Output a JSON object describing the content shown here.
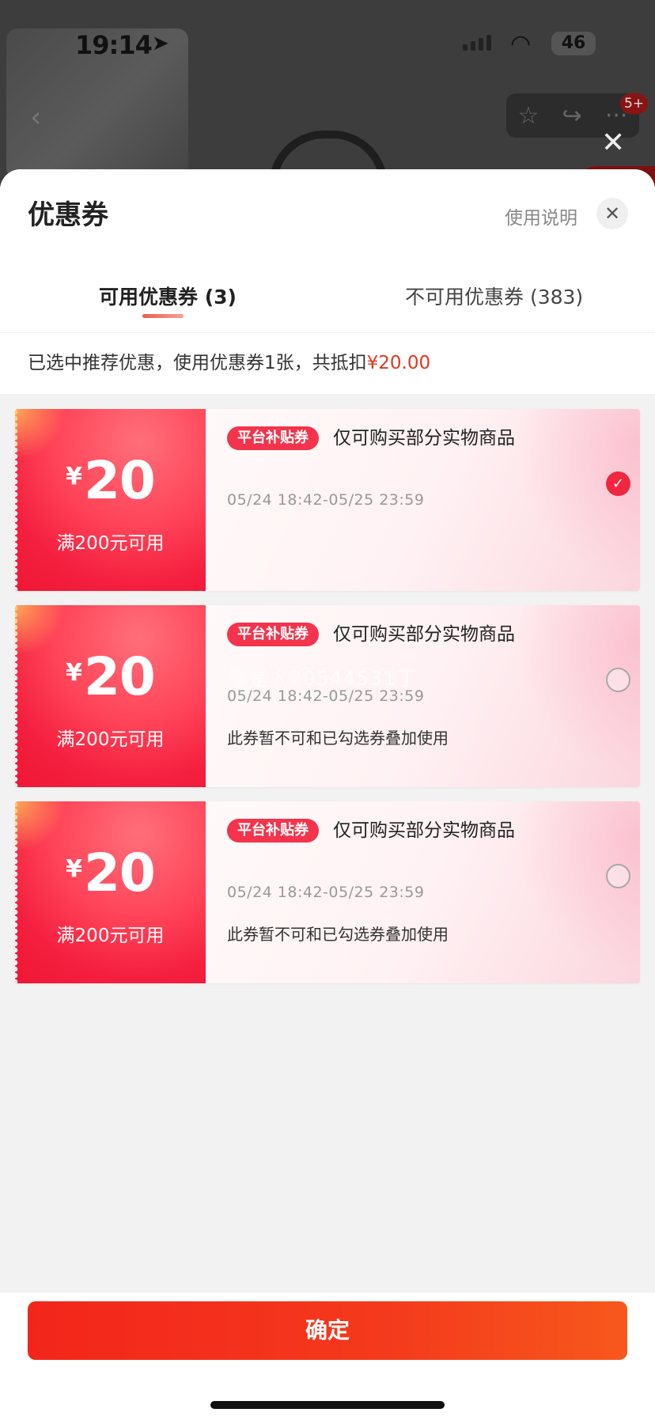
{
  "status_bar": {
    "time": "19:14",
    "battery": "46"
  },
  "background_page": {
    "cart_badge": "5+"
  },
  "sheet": {
    "title": "优惠券",
    "usage_link": "使用说明",
    "tabs": [
      {
        "label": "可用优惠券 (3)",
        "active": true
      },
      {
        "label": "不可用优惠券 (383)",
        "active": false
      }
    ],
    "summary": {
      "text": "已选中推荐优惠，使用优惠券1张，共抵扣",
      "amount": "¥20.00"
    }
  },
  "coupons": [
    {
      "currency": "¥",
      "value": "20",
      "condition": "满200元可用",
      "tag": "平台补贴券",
      "scope": "仅可购买部分实物商品",
      "validity": "05/24 18:42-05/25 23:59",
      "note": "",
      "selected": true
    },
    {
      "currency": "¥",
      "value": "20",
      "condition": "满200元可用",
      "tag": "平台补贴券",
      "scope": "仅可购买部分实物商品",
      "validity": "05/24 18:42-05/25 23:59",
      "note": "此券暂不可和已勾选券叠加使用",
      "selected": false
    },
    {
      "currency": "¥",
      "value": "20",
      "condition": "满200元可用",
      "tag": "平台补贴券",
      "scope": "仅可购买部分实物商品",
      "validity": "05/24 18:42-05/25 23:59",
      "note": "此券暂不可和已勾选券叠加使用",
      "selected": false
    }
  ],
  "watermark": "慢是人70544531丁",
  "footer": {
    "confirm_label": "确定"
  },
  "colors": {
    "accent": "#e8351f",
    "coupon_red": "#f41e3e",
    "confirm_start": "#f3251b",
    "confirm_end": "#f7581c"
  }
}
